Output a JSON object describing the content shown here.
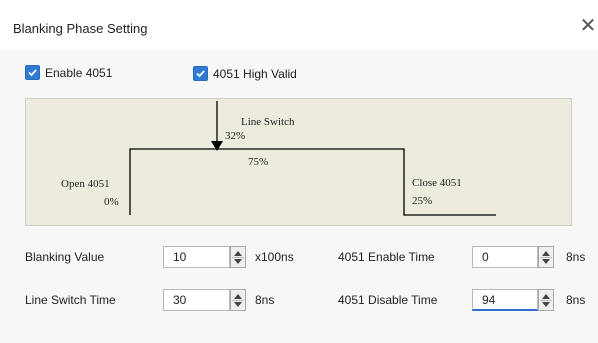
{
  "window": {
    "title": "Blanking Phase Setting",
    "close_icon": "close-icon"
  },
  "options": {
    "enable_4051": {
      "label": "Enable 4051",
      "checked": true
    },
    "high_valid_4051": {
      "label": "4051 High Valid",
      "checked": true
    }
  },
  "diagram": {
    "line_switch_label": "Line Switch",
    "line_switch_value": "32%",
    "high_value": "75%",
    "open_label": "Open 4051",
    "open_value": "0%",
    "close_label": "Close 4051",
    "close_value": "25%"
  },
  "fields": {
    "blanking_value": {
      "label": "Blanking Value",
      "value": "10",
      "unit": "x100ns"
    },
    "line_switch_time": {
      "label": "Line Switch Time",
      "value": "30",
      "unit": "8ns"
    },
    "enable_time_4051": {
      "label": "4051 Enable Time",
      "value": "0",
      "unit": "8ns"
    },
    "disable_time_4051": {
      "label": "4051 Disable Time",
      "value": "94",
      "unit": "8ns"
    }
  },
  "colors": {
    "accent": "#2f7ad4",
    "diagram_bg": "#ecebdd",
    "focus_underline": "#2f6fcf"
  }
}
